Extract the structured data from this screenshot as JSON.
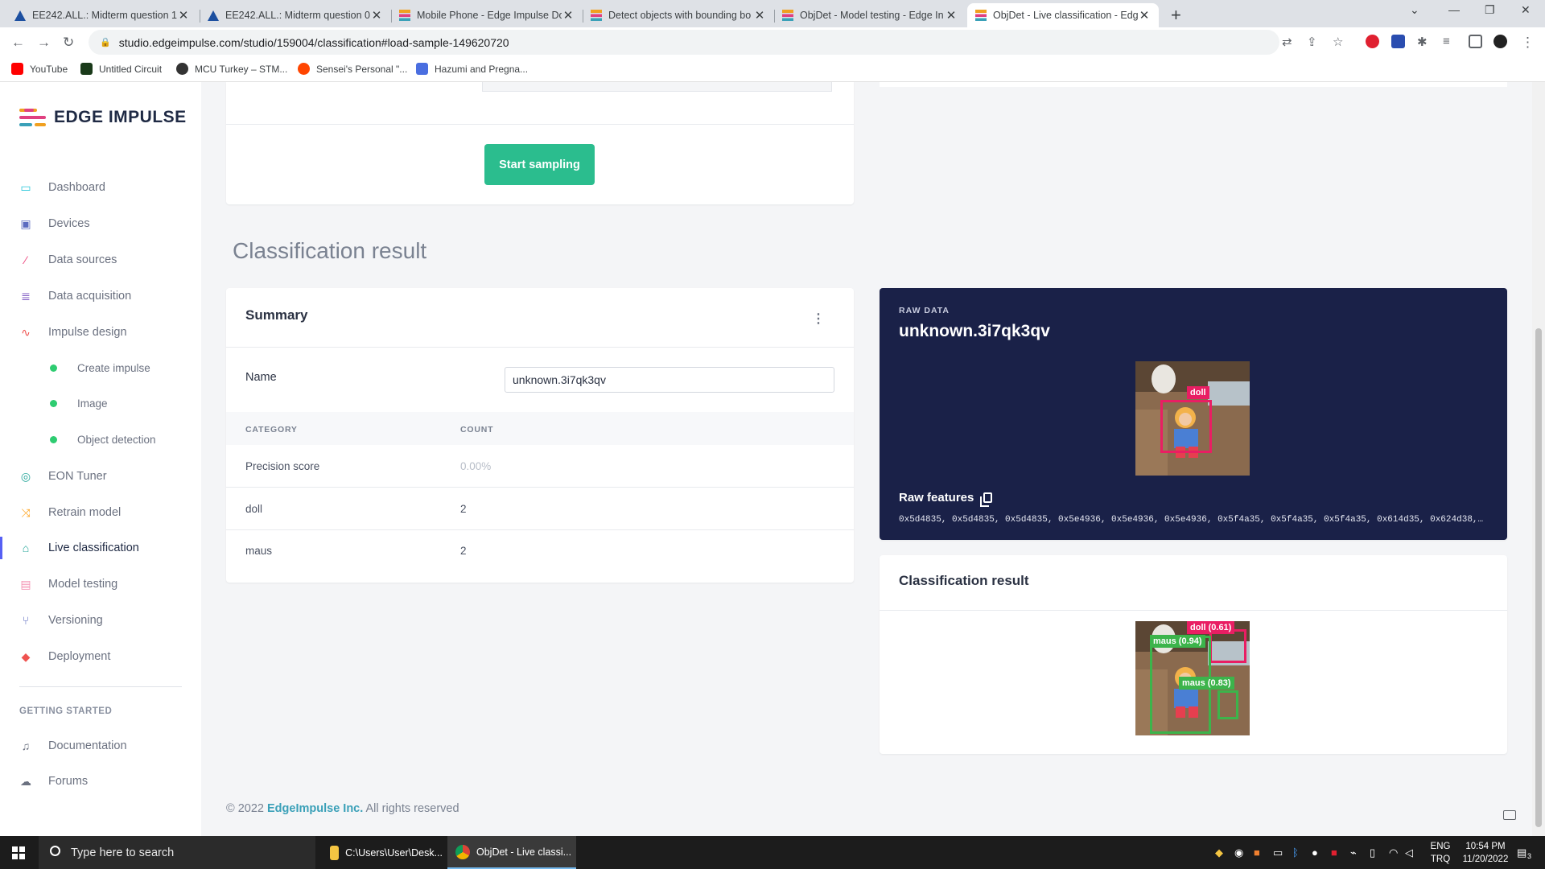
{
  "browser": {
    "tabs": [
      {
        "title": "EE242.ALL.: Midterm question 1",
        "icon_color": "#1c4fa0"
      },
      {
        "title": "EE242.ALL.: Midterm question 0:",
        "icon_color": "#1c4fa0"
      },
      {
        "title": "Mobile Phone - Edge Impulse Do",
        "icon_color": "#f0a020"
      },
      {
        "title": "Detect objects with bounding bo",
        "icon_color": "#f0a020"
      },
      {
        "title": "ObjDet - Model testing - Edge In",
        "icon_color": "#f0a020"
      },
      {
        "title": "ObjDet - Live classification - Edg",
        "icon_color": "#f0a020"
      }
    ],
    "url": "studio.edgeimpulse.com/studio/159004/classification#load-sample-149620720",
    "bookmarks": [
      {
        "label": "YouTube",
        "color": "#ff0000"
      },
      {
        "label": "Untitled Circuit",
        "color": "#1a3a1a"
      },
      {
        "label": "MCU Turkey – STM...",
        "color": "#333333"
      },
      {
        "label": "Sensei's Personal \"...",
        "color": "#ff4500"
      },
      {
        "label": "Hazumi and Pregna...",
        "color": "#4a6ee0"
      }
    ]
  },
  "brand": {
    "name": "EDGE IMPULSE"
  },
  "sidebar": {
    "items": [
      {
        "label": "Dashboard",
        "icon": "monitor-icon",
        "color": "#26c6da"
      },
      {
        "label": "Devices",
        "icon": "chip-icon",
        "color": "#5c6bc0"
      },
      {
        "label": "Data sources",
        "icon": "wand-icon",
        "color": "#ec407a"
      },
      {
        "label": "Data acquisition",
        "icon": "database-icon",
        "color": "#7e57c2"
      },
      {
        "label": "Impulse design",
        "icon": "pulse-icon",
        "color": "#ef5350"
      },
      {
        "label": "EON Tuner",
        "icon": "target-icon",
        "color": "#26a69a"
      },
      {
        "label": "Retrain model",
        "icon": "shuffle-icon",
        "color": "#ffa726"
      },
      {
        "label": "Live classification",
        "icon": "signal-icon",
        "color": "#26a69a"
      },
      {
        "label": "Model testing",
        "icon": "clipboard-icon",
        "color": "#f48fb1"
      },
      {
        "label": "Versioning",
        "icon": "branch-icon",
        "color": "#5c6bc0"
      },
      {
        "label": "Deployment",
        "icon": "cube-icon",
        "color": "#ef5350"
      }
    ],
    "subitems": [
      "Create impulse",
      "Image",
      "Object detection"
    ],
    "getting_started": "GETTING STARTED",
    "help": [
      {
        "label": "Documentation",
        "icon": "book-icon"
      },
      {
        "label": "Forums",
        "icon": "chat-icon"
      }
    ]
  },
  "sampling": {
    "button": "Start sampling"
  },
  "section_title": "Classification result",
  "summary": {
    "title": "Summary",
    "name_label": "Name",
    "name_value": "unknown.3i7qk3qv",
    "col_category": "CATEGORY",
    "col_count": "COUNT",
    "rows": [
      {
        "category": "Precision score",
        "count": "0.00%"
      },
      {
        "category": "doll",
        "count": "2"
      },
      {
        "category": "maus",
        "count": "2"
      }
    ]
  },
  "raw": {
    "label": "RAW DATA",
    "name": "unknown.3i7qk3qv",
    "bbox_label": "doll",
    "features_label": "Raw features",
    "features": "0x5d4835, 0x5d4835, 0x5d4835, 0x5e4936, 0x5e4936, 0x5e4936, 0x5f4a35, 0x5f4a35, 0x5f4a35, 0x614d35, 0x624d38,…"
  },
  "classification": {
    "title": "Classification result",
    "detections": [
      {
        "label": "doll (0.61)",
        "class": "doll",
        "score": 0.61
      },
      {
        "label": "maus (0.94)",
        "class": "maus",
        "score": 0.94
      },
      {
        "label": "maus (0.83)",
        "class": "maus",
        "score": 0.83
      }
    ]
  },
  "footer": {
    "copyright": "© 2022",
    "company": "EdgeImpulse Inc.",
    "rights": "All rights reserved"
  },
  "taskbar": {
    "search_placeholder": "Type here to search",
    "apps": [
      "C:\\Users\\User\\Desk...",
      "ObjDet - Live classi..."
    ],
    "lang_top": "ENG",
    "lang_bottom": "TRQ",
    "time": "10:54 PM",
    "date": "11/20/2022",
    "notifications": "3"
  }
}
